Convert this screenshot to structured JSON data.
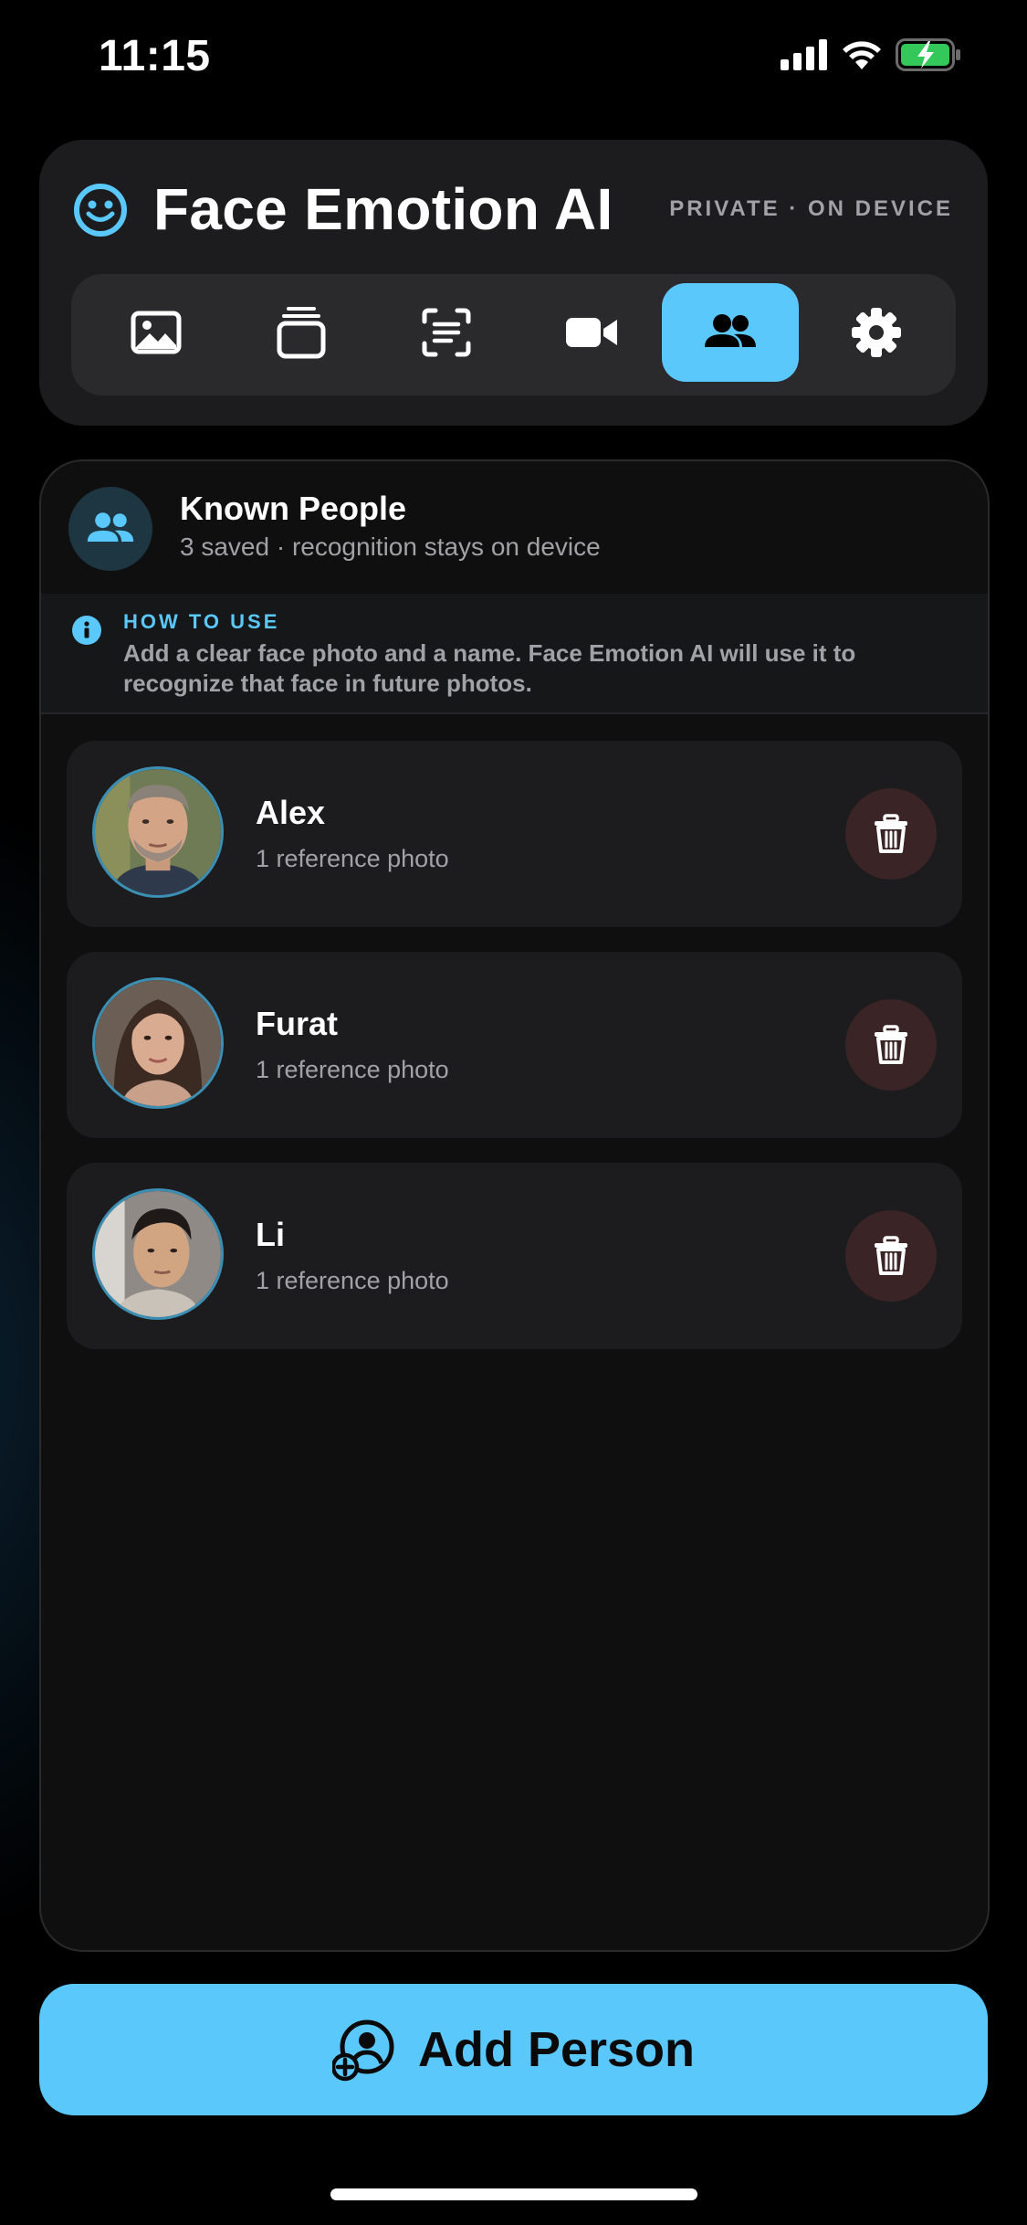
{
  "status_bar": {
    "time": "11:15"
  },
  "header": {
    "title": "Face Emotion AI",
    "privacy_label": "PRIVATE · ON DEVICE",
    "tabs": [
      {
        "icon": "image-icon",
        "active": false
      },
      {
        "icon": "stack-icon",
        "active": false
      },
      {
        "icon": "scan-text-icon",
        "active": false
      },
      {
        "icon": "video-camera-icon",
        "active": false
      },
      {
        "icon": "people-icon",
        "active": true
      },
      {
        "icon": "gear-icon",
        "active": false
      }
    ]
  },
  "panel": {
    "title": "Known People",
    "subtitle": "3 saved · recognition stays on device",
    "info": {
      "label": "HOW TO USE",
      "text": "Add a clear face photo and a name. Face Emotion AI will use it to recognize that face in future photos."
    },
    "people": [
      {
        "name": "Alex",
        "detail": "1 reference photo"
      },
      {
        "name": "Furat",
        "detail": "1 reference photo"
      },
      {
        "name": "Li",
        "detail": "1 reference photo"
      }
    ]
  },
  "add_button": {
    "label": "Add Person"
  },
  "colors": {
    "accent": "#5ac8fa",
    "card": "#1c1c1e",
    "panel": "#0f0f10",
    "muted_text": "#a1a1a6",
    "delete_bg": "#3a2425",
    "battery_green": "#34c759"
  }
}
